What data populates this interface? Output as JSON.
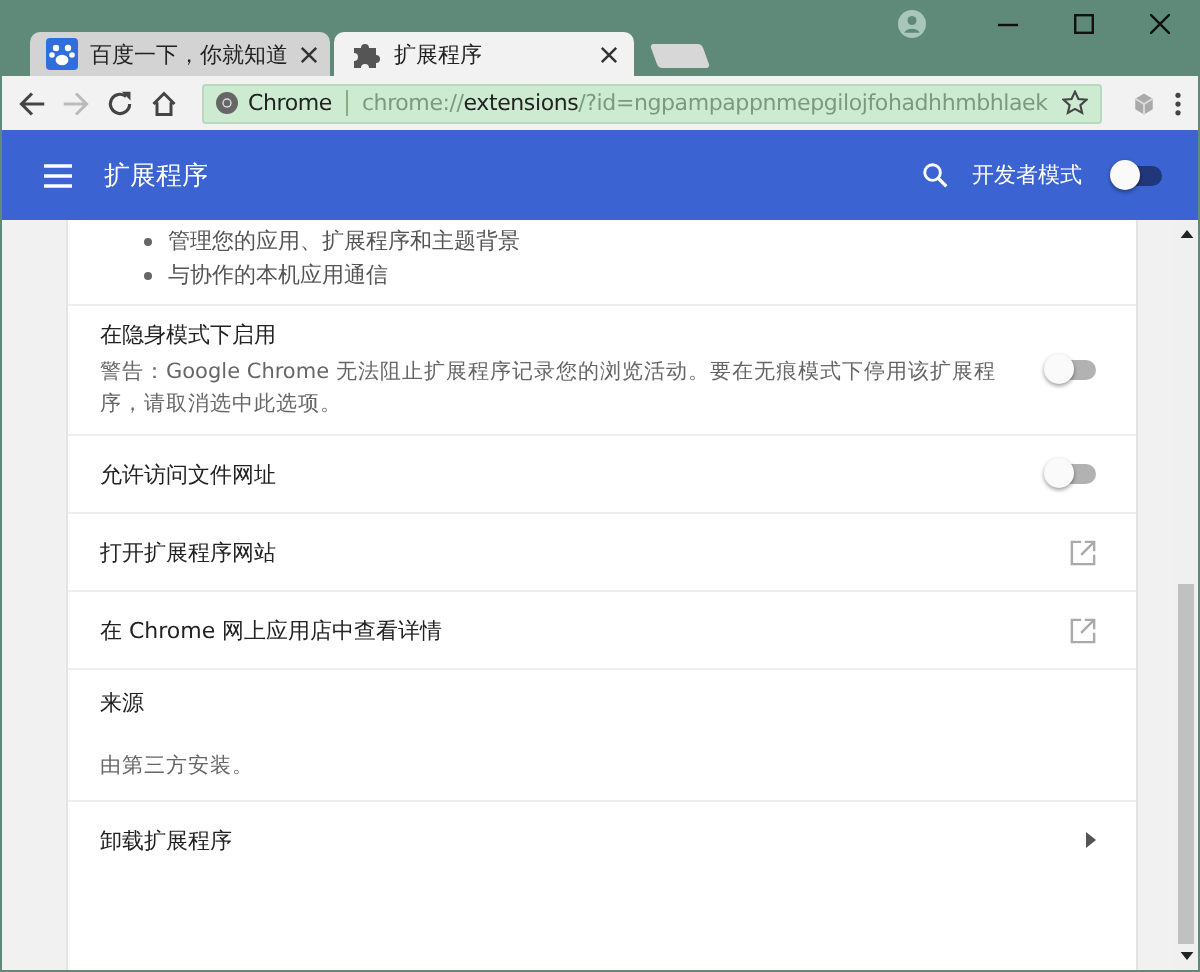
{
  "tabs": [
    {
      "label": "百度一下，你就知道",
      "kind": "paw",
      "selected": false
    },
    {
      "label": "扩展程序",
      "kind": "puzzle",
      "selected": true
    }
  ],
  "address": {
    "security_label": "Chrome",
    "url": {
      "scheme": "chrome://",
      "host": "extensions",
      "path": "/?id=ngpampappnmepgilojfohadhhmbhlaek"
    },
    "bookmarked": false
  },
  "header": {
    "title": "扩展程序",
    "developer_mode": {
      "label": "开发者模式",
      "on": false
    }
  },
  "bullets": [
    "管理您的应用、扩展程序和主题背景",
    "与协作的本机应用通信"
  ],
  "rows": [
    {
      "kind": "toggle",
      "label": "在隐身模式下启用",
      "description": "警告：Google Chrome 无法阻止扩展程序记录您的浏览活动。要在无痕模式下停用该扩展程序，请取消选中此选项。",
      "on": false
    },
    {
      "kind": "toggle",
      "label": "允许访问文件网址",
      "on": false
    },
    {
      "kind": "link",
      "label": "打开扩展程序网站"
    },
    {
      "kind": "link",
      "label": "在 Chrome 网上应用店中查看详情"
    },
    {
      "kind": "info",
      "label": "来源",
      "description": "由第三方安装。"
    },
    {
      "kind": "submenu",
      "label": "卸载扩展程序"
    }
  ]
}
